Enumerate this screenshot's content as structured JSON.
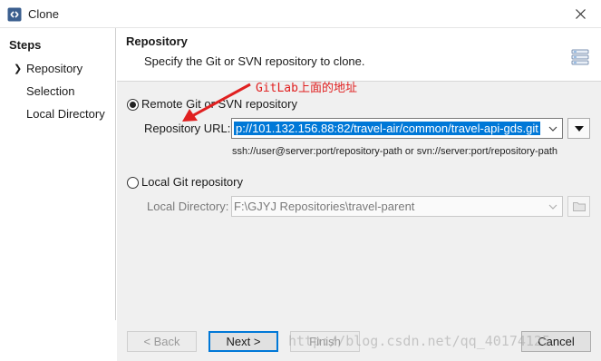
{
  "window": {
    "title": "Clone",
    "icon": "git-clone-icon"
  },
  "steps": {
    "title": "Steps",
    "items": [
      {
        "label": "Repository",
        "active": true
      },
      {
        "label": "Selection",
        "active": false
      },
      {
        "label": "Local Directory",
        "active": false
      }
    ]
  },
  "header": {
    "title": "Repository",
    "description": "Specify the Git or SVN repository to clone."
  },
  "remote": {
    "label": "Remote Git or SVN repository",
    "checked": true,
    "url_label": "Repository URL:",
    "url_value": "p://101.132.156.88:82/travel-air/common/travel-api-gds.git",
    "hint": "ssh://user@server:port/repository-path or svn://server:port/repository-path"
  },
  "local": {
    "label": "Local Git repository",
    "checked": false,
    "dir_label": "Local Directory:",
    "dir_value": "F:\\GJYJ Repositories\\travel-parent"
  },
  "annotation": {
    "text": "GitLab上面的地址",
    "color": "#e02020"
  },
  "buttons": {
    "back": "< Back",
    "next": "Next >",
    "finish": "Finish",
    "cancel": "Cancel"
  },
  "watermark": "http://blog.csdn.net/qq_40174125",
  "colors": {
    "selection": "#0078d7",
    "annotation": "#e02020"
  }
}
